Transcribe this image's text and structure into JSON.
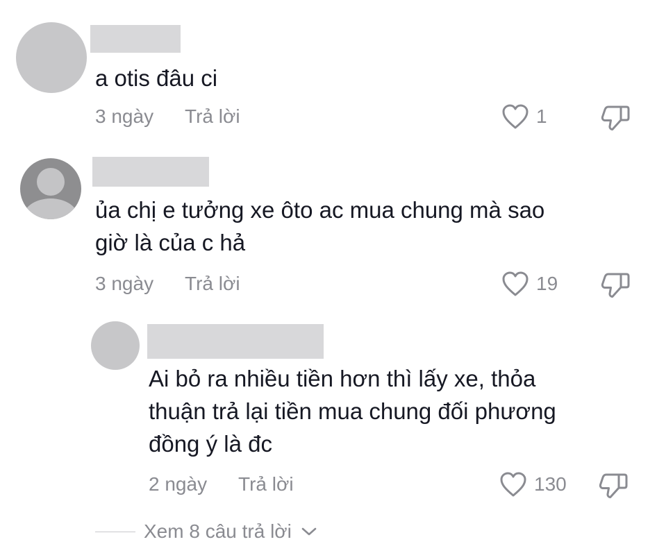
{
  "comments": [
    {
      "text_lines": [
        "a otis đâu ci"
      ],
      "time": "3 ngày",
      "reply_label": "Trả lời",
      "likes": "1"
    },
    {
      "text_lines": [
        "ủa chị e tưởng xe ôto ac mua chung mà sao",
        "giờ là của c hả"
      ],
      "time": "3 ngày",
      "reply_label": "Trả lời",
      "likes": "19"
    },
    {
      "text_lines": [
        "Ai bỏ ra nhiều tiền hơn thì lấy xe, thỏa",
        "thuận trả lại tiền mua chung đối phương",
        "đồng ý là đc"
      ],
      "time": "2 ngày",
      "reply_label": "Trả lời",
      "likes": "130"
    }
  ],
  "view_more": {
    "label": "Xem 8 câu trả lời"
  },
  "icons": {
    "like": "heart-outline-icon",
    "dislike": "thumbs-down-outline-icon",
    "expand": "chevron-down-icon"
  },
  "colors": {
    "text": "#161823",
    "secondary": "#8a8b91",
    "redaction": "#d8d8da",
    "avatar_placeholder": "#c7c7c9"
  }
}
